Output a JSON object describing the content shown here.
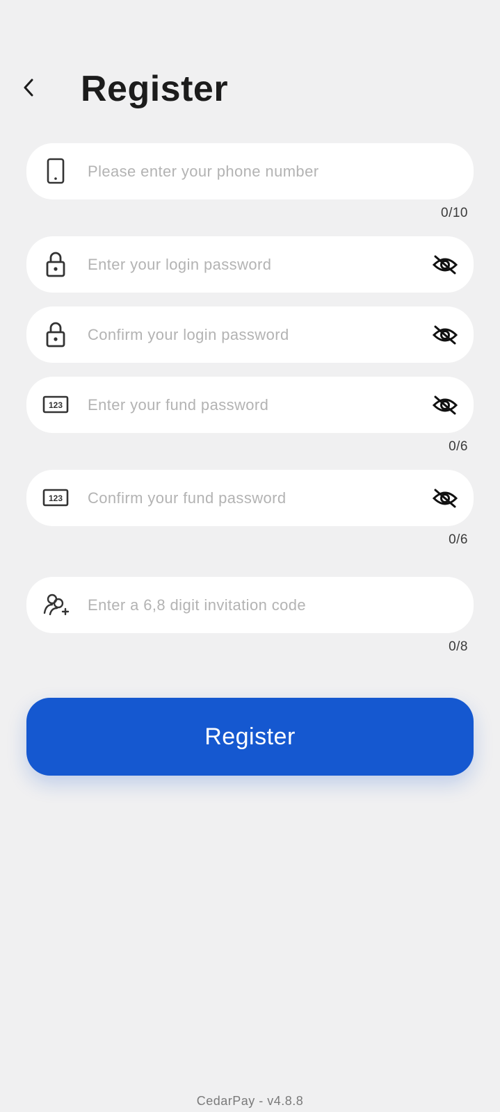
{
  "header": {
    "title": "Register"
  },
  "form": {
    "phone": {
      "placeholder": "Please enter your phone number",
      "value": "",
      "counter": "0/10",
      "icon": "phone-icon"
    },
    "login_password": {
      "placeholder": "Enter your login password",
      "value": "",
      "icon": "lock-icon"
    },
    "confirm_login_password": {
      "placeholder": "Confirm your login password",
      "value": "",
      "icon": "lock-icon"
    },
    "fund_password": {
      "placeholder": "Enter your fund password",
      "value": "",
      "counter": "0/6",
      "icon": "numeric-keypad-icon"
    },
    "confirm_fund_password": {
      "placeholder": "Confirm your fund password",
      "value": "",
      "counter": "0/6",
      "icon": "numeric-keypad-icon"
    },
    "invitation_code": {
      "placeholder": "Enter a 6,8 digit invitation code",
      "value": "",
      "counter": "0/8",
      "icon": "add-user-icon"
    },
    "submit_label": "Register"
  },
  "footer": {
    "version": "CedarPay - v4.8.8"
  },
  "colors": {
    "background": "#f0f0f1",
    "accent": "#1558d0",
    "placeholder": "#b3b3b3"
  }
}
